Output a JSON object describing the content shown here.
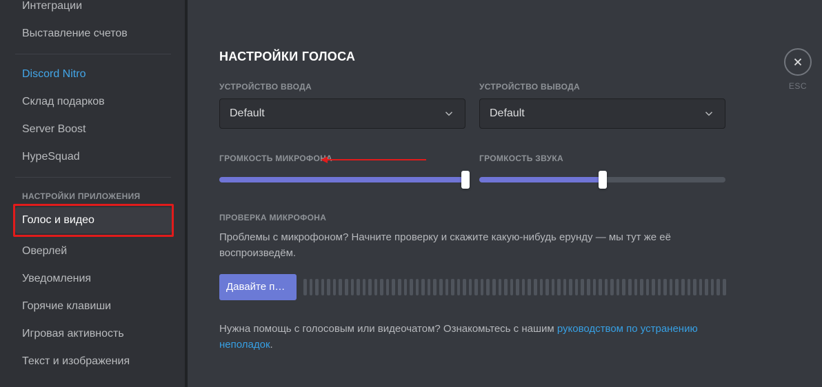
{
  "close": {
    "esc": "ESC"
  },
  "sidebar": {
    "billing_items": [
      "Интеграции",
      "Выставление счетов"
    ],
    "nitro_items": [
      "Discord Nitro",
      "Склад подарков",
      "Server Boost",
      "HypeSquad"
    ],
    "app_header": "НАСТРОЙКИ ПРИЛОЖЕНИЯ",
    "app_items": [
      "Голос и видео",
      "Оверлей",
      "Уведомления",
      "Горячие клавиши",
      "Игровая активность",
      "Текст и изображения"
    ]
  },
  "title": "НАСТРОЙКИ ГОЛОСА",
  "input_device": {
    "label": "УСТРОЙСТВО ВВОДА",
    "value": "Default"
  },
  "output_device": {
    "label": "УСТРОЙСТВО ВЫВОДА",
    "value": "Default"
  },
  "mic_volume": {
    "label": "ГРОМКОСТЬ МИКРОФОНА",
    "percent": 100
  },
  "out_volume": {
    "label": "ГРОМКОСТЬ ЗВУКА",
    "percent": 50
  },
  "mic_test": {
    "label": "ПРОВЕРКА МИКРОФОНА",
    "desc": "Проблемы с микрофоном? Начните проверку и скажите какую-нибудь ерунду — мы тут же её воспроизведём.",
    "button": "Давайте пр…"
  },
  "help": {
    "prefix": "Нужна помощь с голосовым или видеочатом? Ознакомьтесь с нашим ",
    "link": "руководством по устранению неполадок",
    "suffix": "."
  }
}
